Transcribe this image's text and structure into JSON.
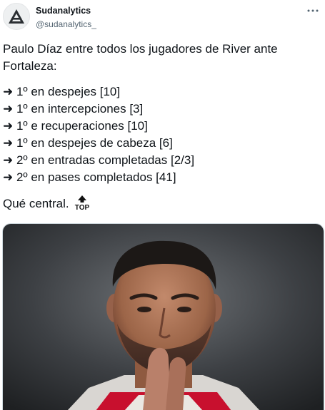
{
  "account": {
    "display_name": "Sudanalytics",
    "handle": "@sudanalytics_"
  },
  "icons": {
    "avatar": "sudanalytics-logo",
    "more": "more-options-icon",
    "top_emoji": "top-arrow-emoji"
  },
  "tweet": {
    "intro_line_1": "Paulo Díaz entre todos los jugadores de River ante",
    "intro_line_2": "Fortaleza:",
    "stats": [
      "➜ 1º en despejes [10]",
      "➜ 1º en intercepciones [3]",
      "➜ 1º e recuperaciones [10]",
      "➜ 1º en despejes de cabeza [6]",
      "➜ 2º en entradas completadas [2/3]",
      "➜ 2º en pases completados [41]"
    ],
    "closing": "Qué central.",
    "top_emoji_text": "TOP"
  },
  "colors": {
    "text": "#0f1419",
    "secondary": "#536471",
    "jersey_red": "#c8102e"
  }
}
